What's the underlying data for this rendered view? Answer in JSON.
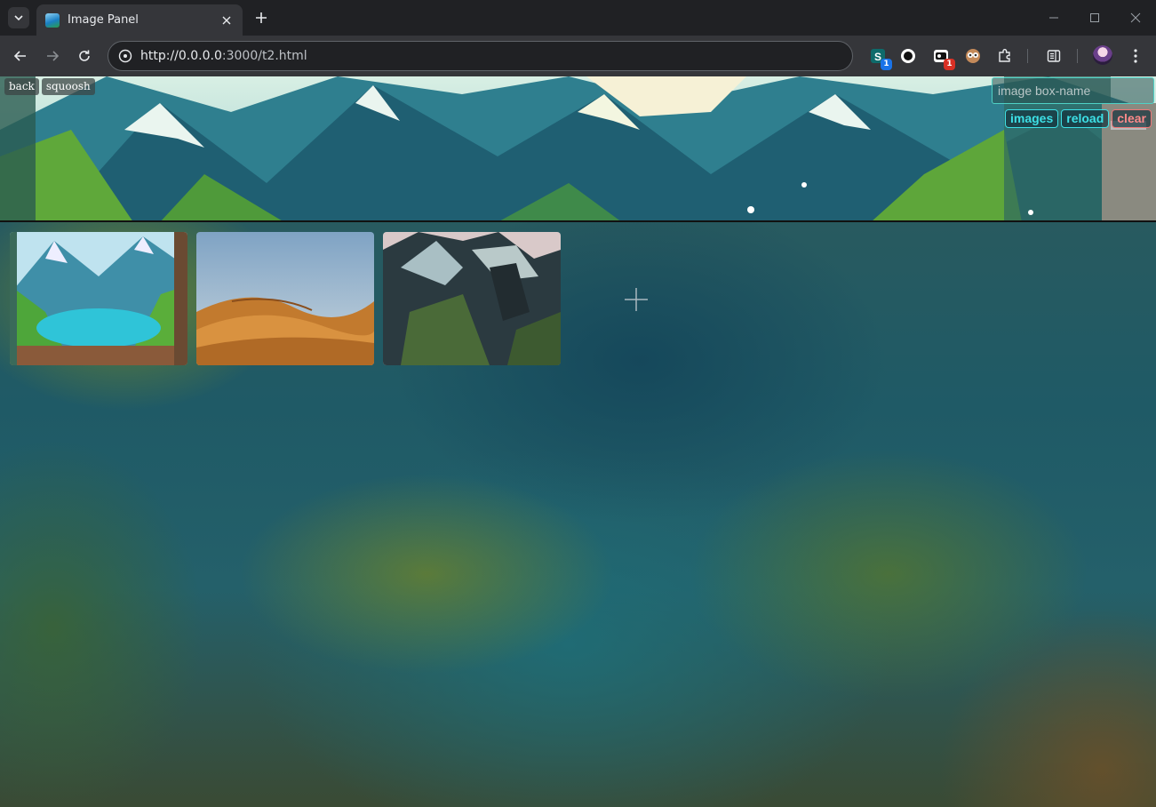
{
  "browser": {
    "tab_title": "Image Panel",
    "url_host": "http://0.0.0.0",
    "url_rest": ":3000/t2.html",
    "extensions": [
      {
        "icon": "s-extension-icon",
        "badge": "1",
        "badge_color": "#1a73e8"
      },
      {
        "icon": "circle-extension-icon",
        "badge": "",
        "badge_color": ""
      },
      {
        "icon": "camera-extension-icon",
        "badge": "1",
        "badge_color": "#d93025"
      },
      {
        "icon": "owl-extension-icon",
        "badge": "",
        "badge_color": ""
      },
      {
        "icon": "puzzle-icon",
        "badge": "",
        "badge_color": ""
      }
    ]
  },
  "page": {
    "back_label": "back",
    "squoosh_label": "squoosh",
    "name_input_placeholder": "image box-name",
    "name_input_value": "",
    "images_label": "images",
    "reload_label": "reload",
    "clear_label": "clear",
    "thumbnails": [
      {
        "name": "thumbnail-lake-valley",
        "subject": "lake-valley"
      },
      {
        "name": "thumbnail-desert-dunes",
        "subject": "desert-dunes"
      },
      {
        "name": "thumbnail-rocky-mountain",
        "subject": "rocky-mountain"
      }
    ],
    "add_icon": "plus-icon"
  },
  "colors": {
    "accent_cyan": "#3de0e6",
    "clear_red": "#ff8a8a",
    "chrome_dark": "#202124",
    "chrome_toolbar": "#35363a"
  }
}
